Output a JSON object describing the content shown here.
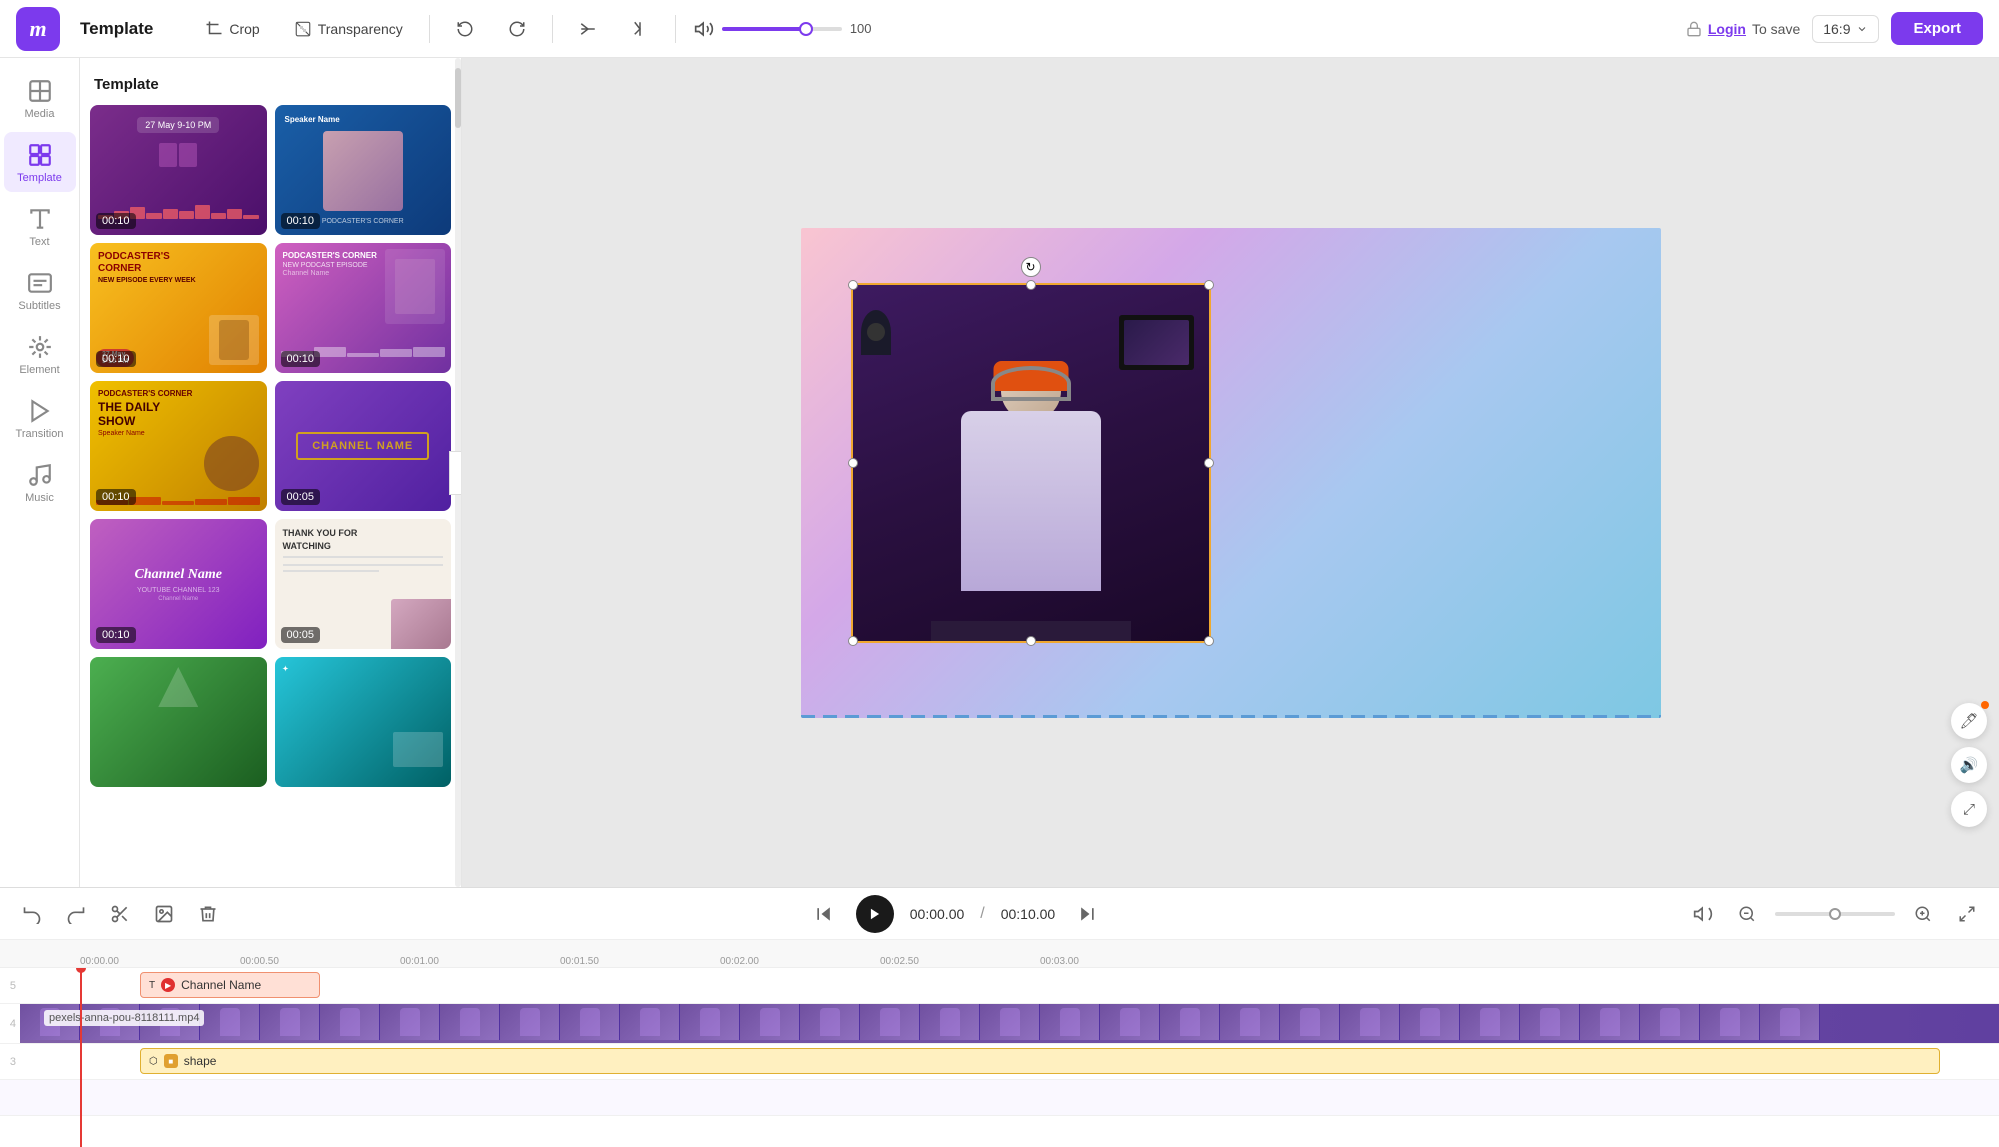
{
  "app": {
    "logo": "m",
    "title": "Template"
  },
  "topbar": {
    "crop_label": "Crop",
    "transparency_label": "Transparency",
    "volume_value": "100",
    "login_text": "Login",
    "login_suffix": "To save",
    "ratio_label": "16:9",
    "export_label": "Export"
  },
  "sidebar": {
    "items": [
      {
        "id": "media",
        "label": "Media",
        "icon": "plus-grid"
      },
      {
        "id": "template",
        "label": "Template",
        "icon": "template",
        "active": true
      },
      {
        "id": "text",
        "label": "Text",
        "icon": "text"
      },
      {
        "id": "subtitles",
        "label": "Subtitles",
        "icon": "subtitles"
      },
      {
        "id": "element",
        "label": "Element",
        "icon": "element"
      },
      {
        "id": "transition",
        "label": "Transition",
        "icon": "transition"
      },
      {
        "id": "music",
        "label": "Music",
        "icon": "music"
      }
    ]
  },
  "template_panel": {
    "title": "Template",
    "cards": [
      {
        "id": "t1",
        "label": "00:10",
        "style": "purple",
        "text": "27 May 9-10 PM"
      },
      {
        "id": "t2",
        "label": "00:10",
        "style": "blue",
        "text": "Speaker Name"
      },
      {
        "id": "t3",
        "label": "00:10",
        "style": "yellow",
        "text": "PODCASTER'S CORNER\nNEW EPISODE EVERY WEEK"
      },
      {
        "id": "t4",
        "label": "00:10",
        "style": "pink-purple",
        "text": "PODCASTER'S CORNER\nNEW PODCAST EPISODE"
      },
      {
        "id": "t5",
        "label": "00:10",
        "style": "yellow-dark",
        "text": "PODCASTER'S CORNER\nTHE DAILY SHOW"
      },
      {
        "id": "t6",
        "label": "00:05",
        "style": "violet",
        "text": "CHANNEL NAME"
      },
      {
        "id": "t7",
        "label": "00:10",
        "style": "purple-grad",
        "text": "Channel Name"
      },
      {
        "id": "t8",
        "label": "00:05",
        "style": "gray",
        "text": "THANK YOU FOR WATCHING"
      },
      {
        "id": "t9",
        "label": "",
        "style": "green",
        "text": ""
      },
      {
        "id": "t10",
        "label": "",
        "style": "blue-teal",
        "text": ""
      }
    ]
  },
  "timeline": {
    "current_time": "00:00.00",
    "total_time": "00:10.00",
    "rulers": [
      "00:00.00",
      "00:00.50",
      "00:01.00",
      "00:01.50",
      "00:02.00",
      "00:02.50",
      "00:03.00"
    ],
    "tracks": [
      {
        "num": "5",
        "type": "text",
        "label": "Channel Name",
        "start_pct": 8
      },
      {
        "num": "4",
        "type": "video",
        "label": "pexels-anna-pou-8118111.mp4"
      },
      {
        "num": "3",
        "type": "shape",
        "label": "shape"
      }
    ],
    "playhead_label": "00:00.00"
  },
  "toolbar": {
    "undo_label": "undo",
    "redo_label": "redo",
    "cut_label": "cut",
    "image_label": "image",
    "delete_label": "delete"
  }
}
